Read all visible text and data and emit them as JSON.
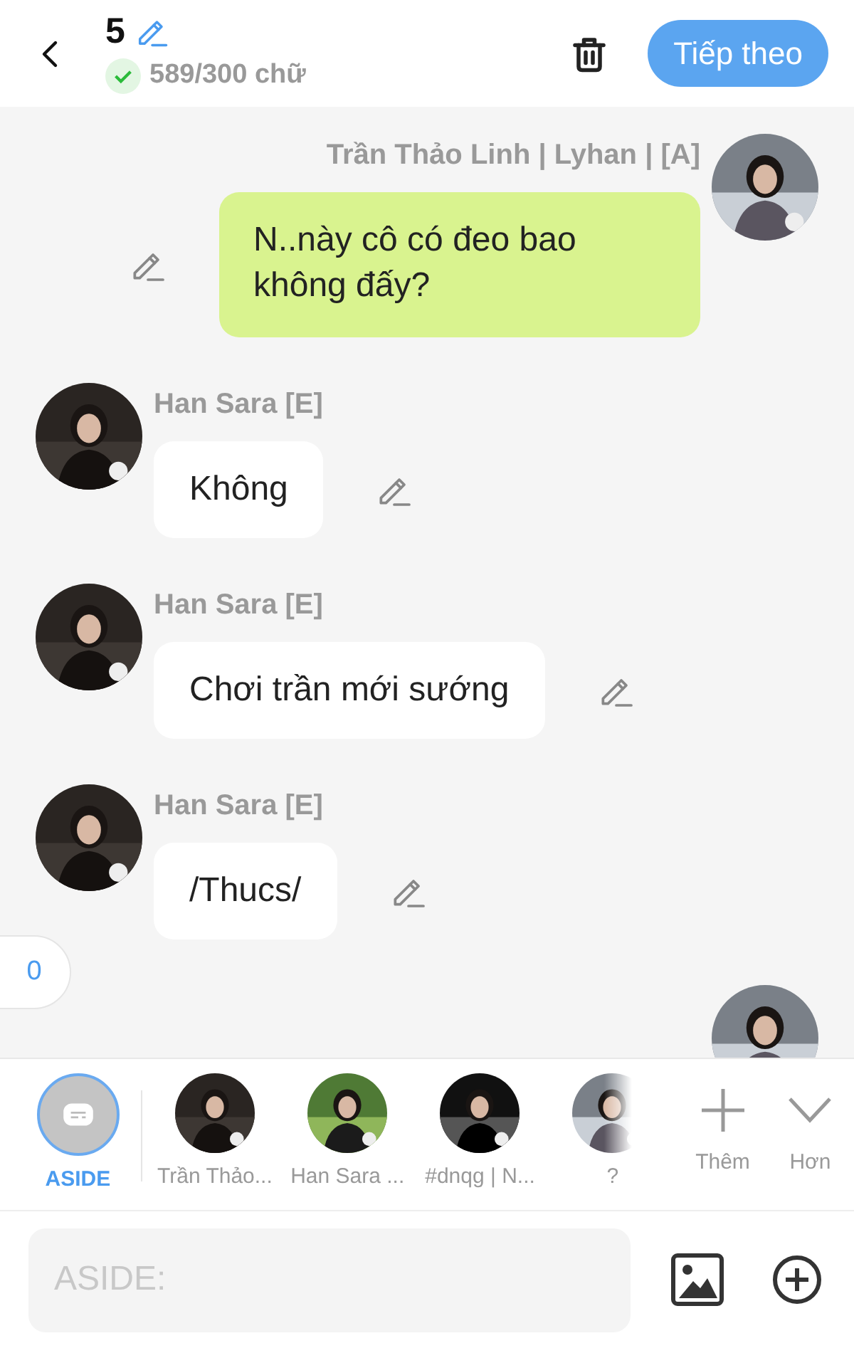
{
  "header": {
    "count": "5",
    "word_count": "589/300 chữ",
    "next_button": "Tiếp theo"
  },
  "messages": [
    {
      "kind": "sent",
      "name": "Trần Thảo Linh | Lyhan | [A]",
      "text": "N..này cô có đeo bao không đấy?"
    },
    {
      "kind": "received",
      "name": "Han Sara [E]",
      "text": "Không"
    },
    {
      "kind": "received",
      "name": "Han Sara [E]",
      "text": "Chơi trần mới sướng"
    },
    {
      "kind": "received",
      "name": "Han Sara [E]",
      "text": "/Thucs/"
    }
  ],
  "side_tab": {
    "label": "0"
  },
  "characters": [
    {
      "kind": "aside",
      "label": "ASIDE",
      "selected": true
    },
    {
      "kind": "avatar",
      "label": "Trần Thảo...",
      "selected": false
    },
    {
      "kind": "avatar",
      "label": "Han Sara ...",
      "selected": false
    },
    {
      "kind": "avatar",
      "label": "#dnqg | N...",
      "selected": false
    },
    {
      "kind": "avatar",
      "label": "?",
      "selected": false
    }
  ],
  "actions": [
    {
      "kind": "add",
      "label": "Thêm"
    },
    {
      "kind": "more",
      "label": "Hơn"
    }
  ],
  "input": {
    "placeholder": "ASIDE:"
  }
}
